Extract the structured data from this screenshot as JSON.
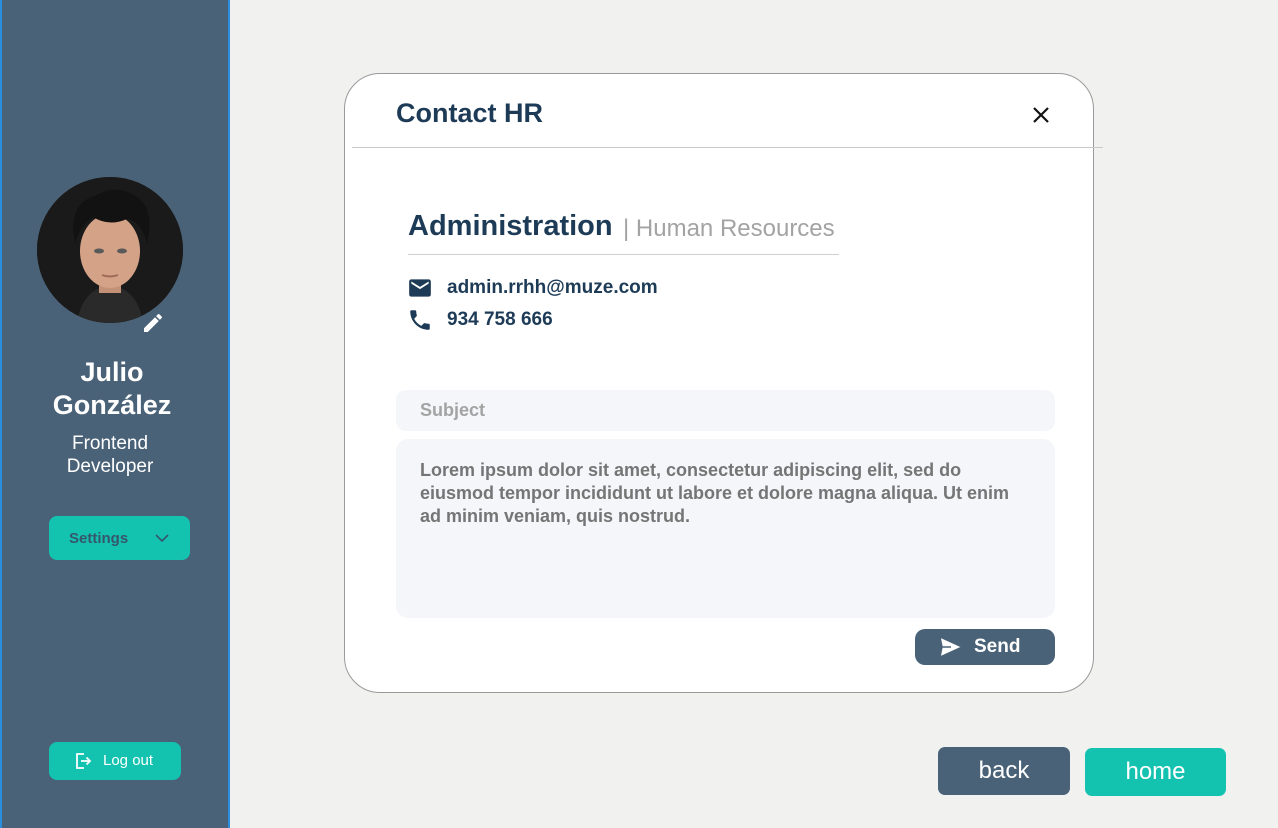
{
  "sidebar": {
    "user": {
      "first_name": "Julio",
      "last_name": "González",
      "role_line1": "Frontend",
      "role_line2": "Developer"
    },
    "settings_label": "Settings",
    "logout_label": "Log out"
  },
  "modal": {
    "title": "Contact HR",
    "department": "Administration",
    "department_sub": "| Human Resources",
    "email": "admin.rrhh@muze.com",
    "phone": "934 758 666",
    "subject_placeholder": "Subject",
    "message_placeholder": "Lorem ipsum dolor sit amet, consectetur adipiscing elit, sed do eiusmod tempor incididunt ut labore et dolore magna aliqua. Ut enim ad minim veniam, quis nostrud.",
    "send_label": "Send"
  },
  "footer": {
    "back_label": "back",
    "home_label": "home"
  },
  "colors": {
    "sidebar": "#4a6277",
    "accent": "#14c2b0",
    "heading": "#1d3b56",
    "background": "#f1f1f0"
  },
  "icons": [
    "pencil-icon",
    "chevron-down-icon",
    "logout-icon",
    "close-icon",
    "mail-icon",
    "phone-icon",
    "send-icon"
  ]
}
